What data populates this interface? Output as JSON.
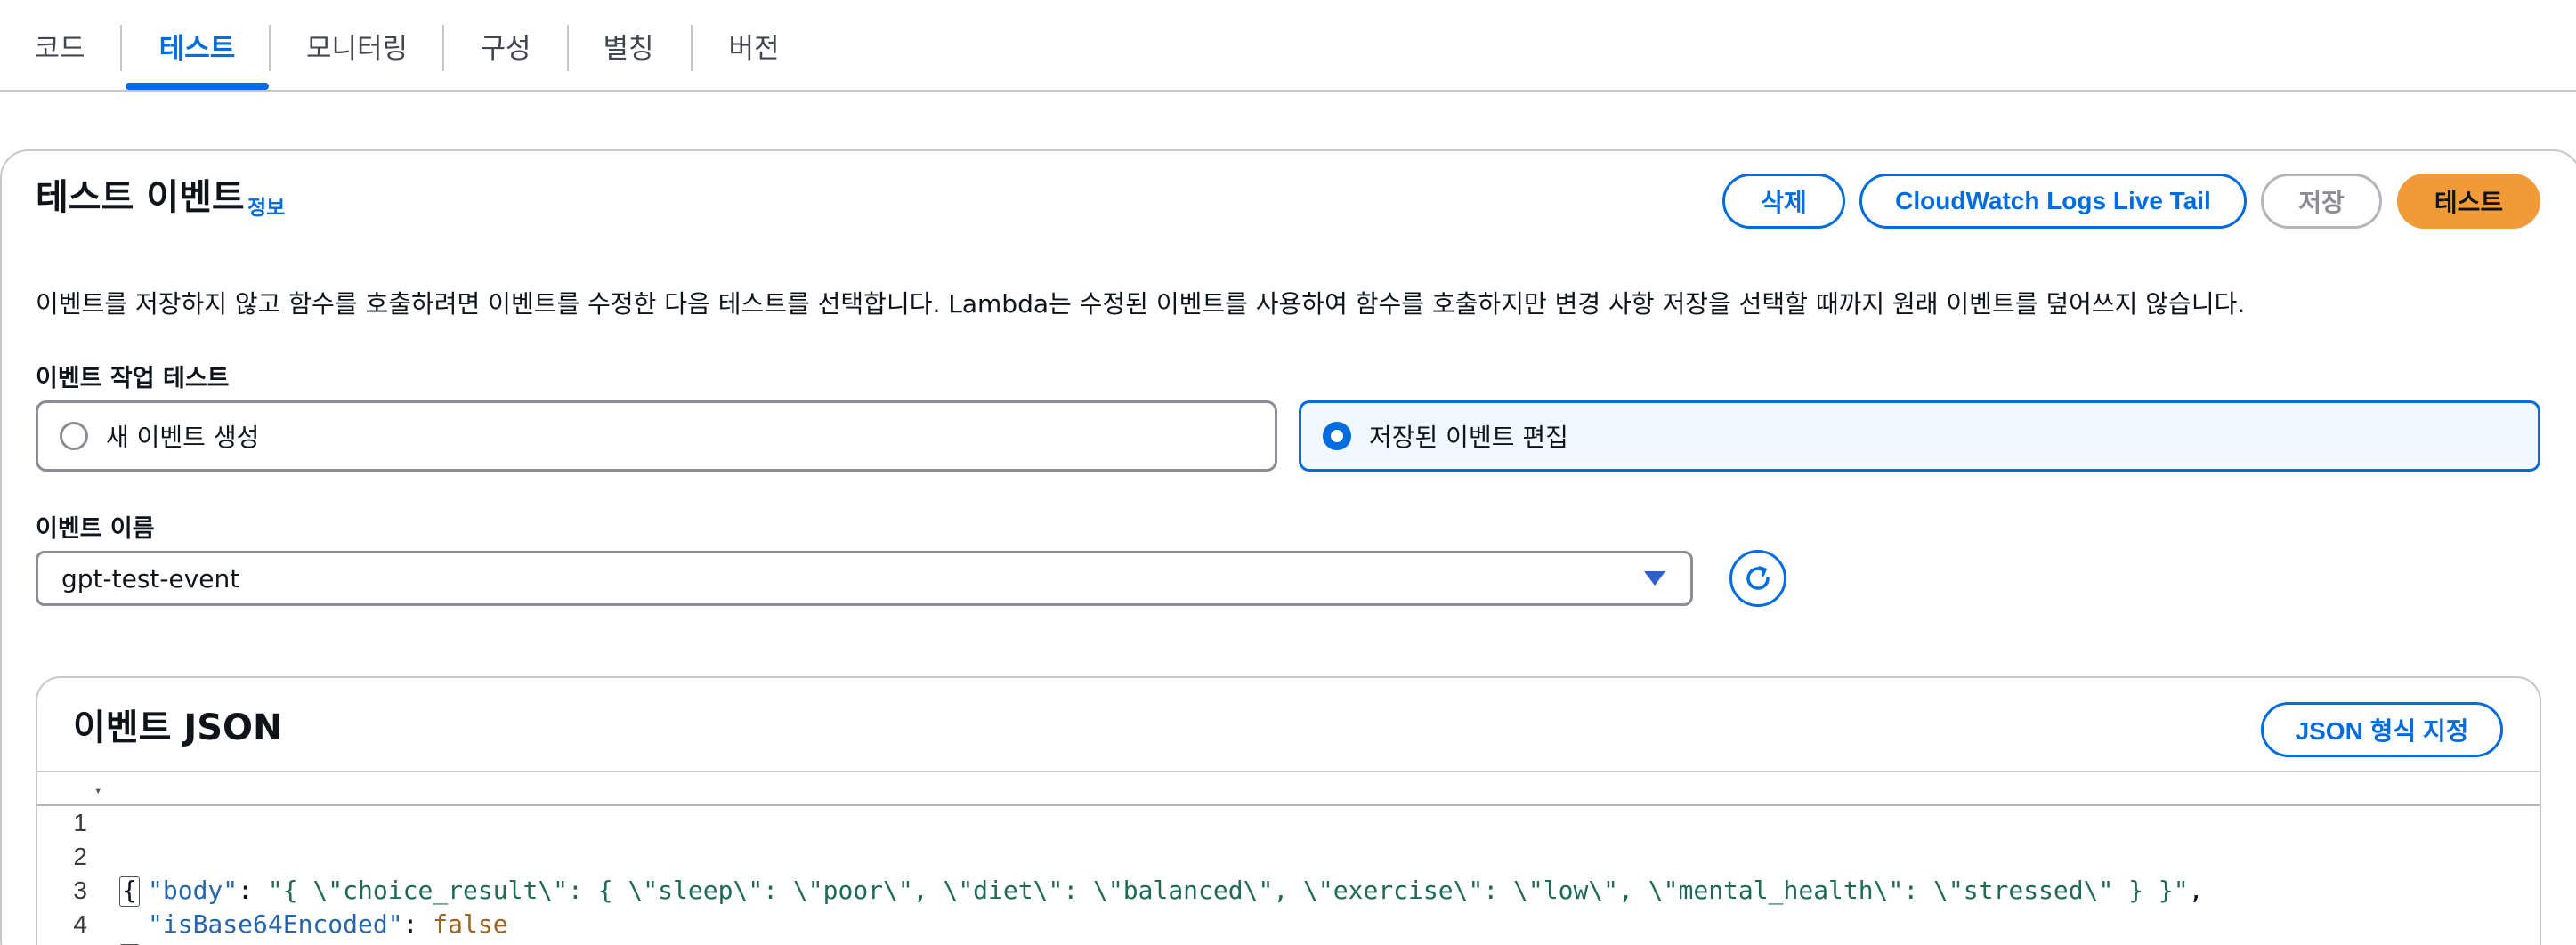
{
  "tabs": [
    {
      "label": "코드"
    },
    {
      "label": "테스트"
    },
    {
      "label": "모니터링"
    },
    {
      "label": "구성"
    },
    {
      "label": "별칭"
    },
    {
      "label": "버전"
    }
  ],
  "active_tab": "테스트",
  "panel": {
    "title": "테스트 이벤트",
    "info_link": "정보",
    "buttons": {
      "delete": "삭제",
      "live_tail": "CloudWatch Logs Live Tail",
      "save": "저장",
      "test": "테스트"
    },
    "description": "이벤트를 저장하지 않고 함수를 호출하려면 이벤트를 수정한 다음 테스트를 선택합니다. Lambda는 수정된 이벤트를 사용하여 함수를 호출하지만 변경 사항 저장을 선택할 때까지 원래 이벤트를 덮어쓰지 않습니다.",
    "event_action": {
      "label": "이벤트 작업 테스트",
      "options": [
        {
          "label": "새 이벤트 생성",
          "selected": false
        },
        {
          "label": "저장된 이벤트 편집",
          "selected": true
        }
      ]
    },
    "event_name": {
      "label": "이벤트 이름",
      "value": "gpt-test-event"
    },
    "editor": {
      "title": "이벤트 JSON",
      "format_button": "JSON 형식 지정",
      "line_numbers": [
        "1",
        "2",
        "3",
        "4"
      ],
      "lines": {
        "open_brace": "{",
        "body_key": "\"body\"",
        "colon1": ": ",
        "body_value": "\"{ \\\"choice_result\\\": { \\\"sleep\\\": \\\"poor\\\", \\\"diet\\\": \\\"balanced\\\", \\\"exercise\\\": \\\"low\\\", \\\"mental_health\\\": \\\"stressed\\\" } }\"",
        "comma": ",",
        "b64_key": "\"isBase64Encoded\"",
        "colon2": ": ",
        "b64_value": "false",
        "close_brace": "}"
      }
    }
  },
  "colors": {
    "accent": "#006ce0",
    "primary_button": "#f09a38",
    "border": "#8c8c94"
  }
}
